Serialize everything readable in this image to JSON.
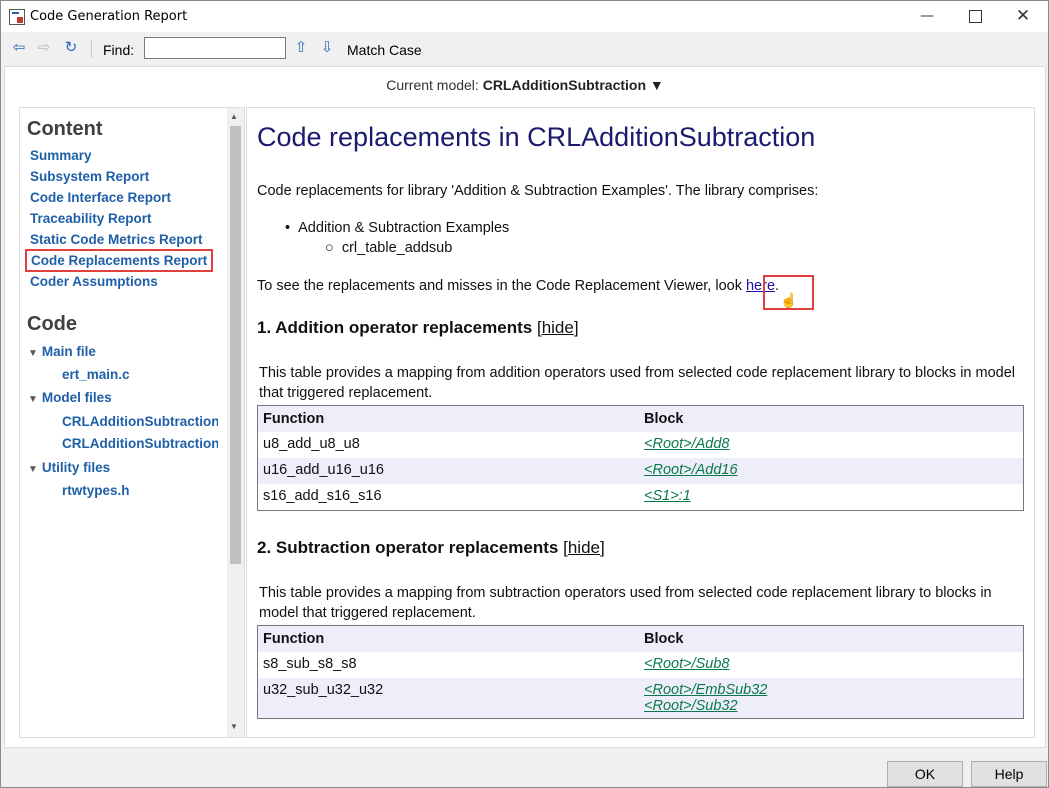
{
  "window": {
    "title": "Code Generation Report"
  },
  "toolbar": {
    "find_label": "Find:",
    "find_value": "",
    "match_case_label": "Match Case"
  },
  "model_bar": {
    "prefix": "Current model:",
    "model": "CRLAdditionSubtraction",
    "arrow": "▼"
  },
  "nav": {
    "content_heading": "Content",
    "content_links": [
      "Summary",
      "Subsystem Report",
      "Code Interface Report",
      "Traceability Report",
      "Static Code Metrics Report",
      "Code Replacements Report",
      "Coder Assumptions"
    ],
    "code_heading": "Code",
    "main_file_label": "Main file",
    "main_files": [
      "ert_main.c"
    ],
    "model_files_label": "Model files",
    "model_files": [
      "CRLAdditionSubtraction",
      "CRLAdditionSubtraction"
    ],
    "utility_files_label": "Utility files",
    "utility_files": [
      "rtwtypes.h"
    ]
  },
  "content": {
    "title": "Code replacements in CRLAdditionSubtraction",
    "intro": "Code replacements for library 'Addition & Subtraction Examples'. The library comprises:",
    "library_item": "Addition & Subtraction Examples",
    "library_subitem": "crl_table_addsub",
    "viewer_text": "To see the replacements and misses in the Code Replacement Viewer, look ",
    "viewer_link": "here",
    "viewer_end": ".",
    "sections": [
      {
        "heading": "1. Addition operator replacements",
        "hide_label": "hide",
        "description": "This table provides a mapping from addition operators used from selected code replacement library to blocks in model that triggered replacement.",
        "columns": [
          "Function",
          "Block"
        ],
        "rows": [
          {
            "function": "u8_add_u8_u8",
            "blocks": [
              "<Root>/Add8"
            ]
          },
          {
            "function": "u16_add_u16_u16",
            "blocks": [
              "<Root>/Add16"
            ]
          },
          {
            "function": "s16_add_s16_s16",
            "blocks": [
              "<S1>:1"
            ]
          }
        ]
      },
      {
        "heading": "2. Subtraction operator replacements",
        "hide_label": "hide",
        "description": "This table provides a mapping from subtraction operators used from selected code replacement library to blocks in model that triggered replacement.",
        "columns": [
          "Function",
          "Block"
        ],
        "rows": [
          {
            "function": "s8_sub_s8_s8",
            "blocks": [
              "<Root>/Sub8"
            ]
          },
          {
            "function": "u32_sub_u32_u32",
            "blocks": [
              "<Root>/EmbSub32",
              "<Root>/Sub32"
            ]
          }
        ]
      }
    ]
  },
  "footer": {
    "ok_label": "OK",
    "help_label": "Help"
  }
}
